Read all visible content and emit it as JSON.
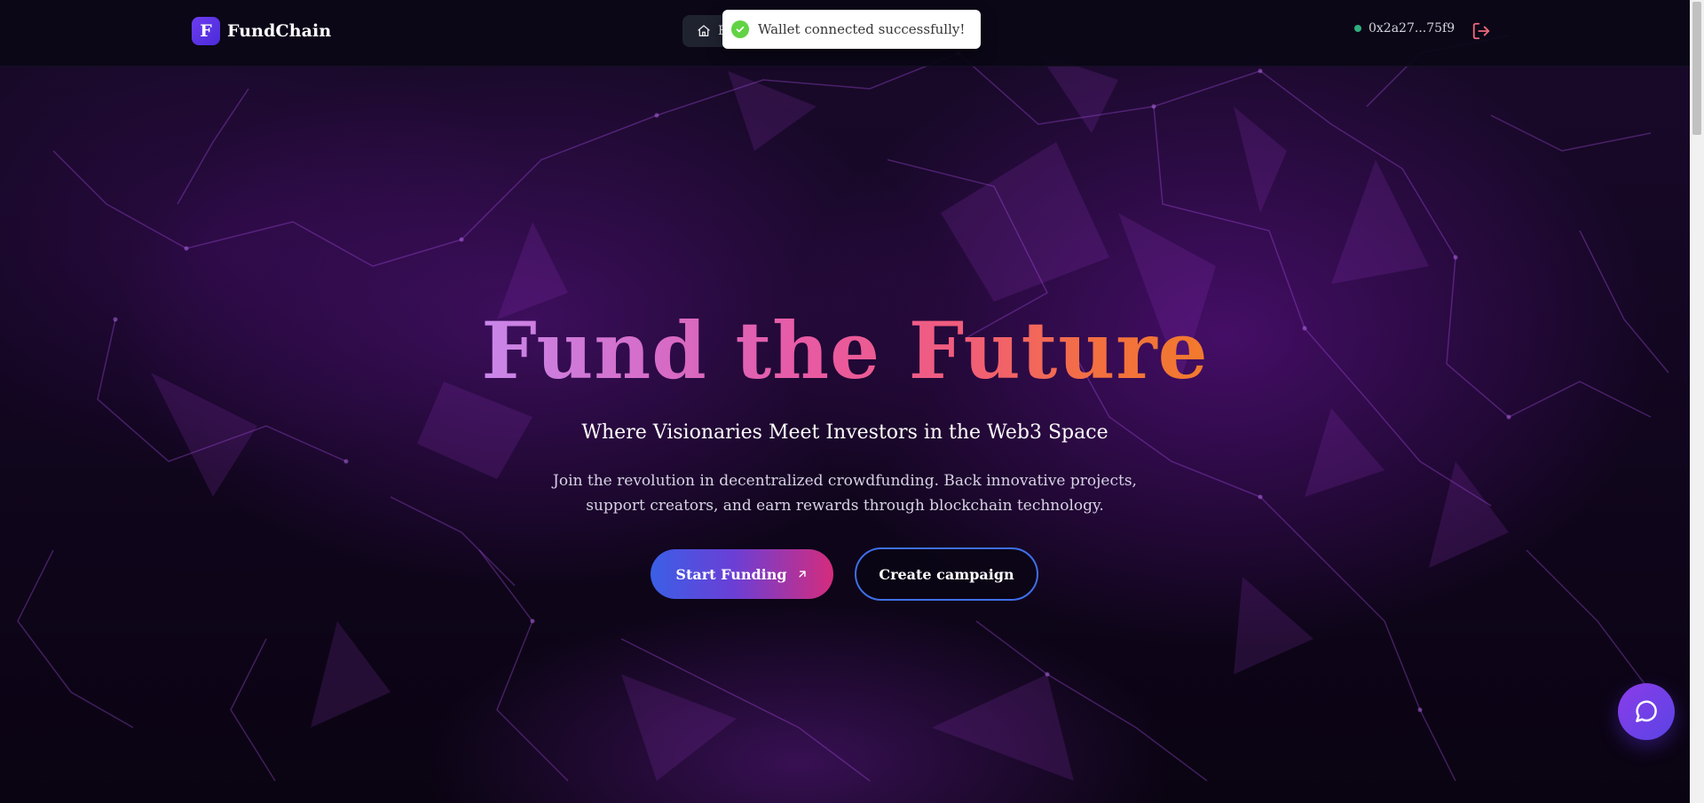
{
  "header": {
    "brand_initial": "F",
    "brand_name": "FundChain",
    "nav_pill_label": "F",
    "wallet_address": "0x2a27...75f9"
  },
  "toast": {
    "message": "Wallet connected successfully!",
    "status": "success",
    "icon": "check-circle-icon"
  },
  "hero": {
    "title": "Fund the Future",
    "subtitle": "Where Visionaries Meet Investors in the Web3 Space",
    "description": "Join the revolution in decentralized crowdfunding. Back innovative projects, support creators, and earn rewards through blockchain technology.",
    "primary_button_label": "Start Funding",
    "secondary_button_label": "Create campaign"
  },
  "icons": {
    "home": "home-icon",
    "chevron": "chevron-down-icon",
    "logout": "logout-icon",
    "arrow": "arrow-up-right-icon",
    "chat": "chat-bubble-icon"
  },
  "colors": {
    "brand": "#5b35e0",
    "toast_success": "#61d345",
    "wallet_status": "#2fae7d",
    "logout": "#f06a7c",
    "primary_gradient_start": "#3b5fe6",
    "primary_gradient_end": "#d42c7c",
    "secondary_border": "#3e6fe8"
  }
}
